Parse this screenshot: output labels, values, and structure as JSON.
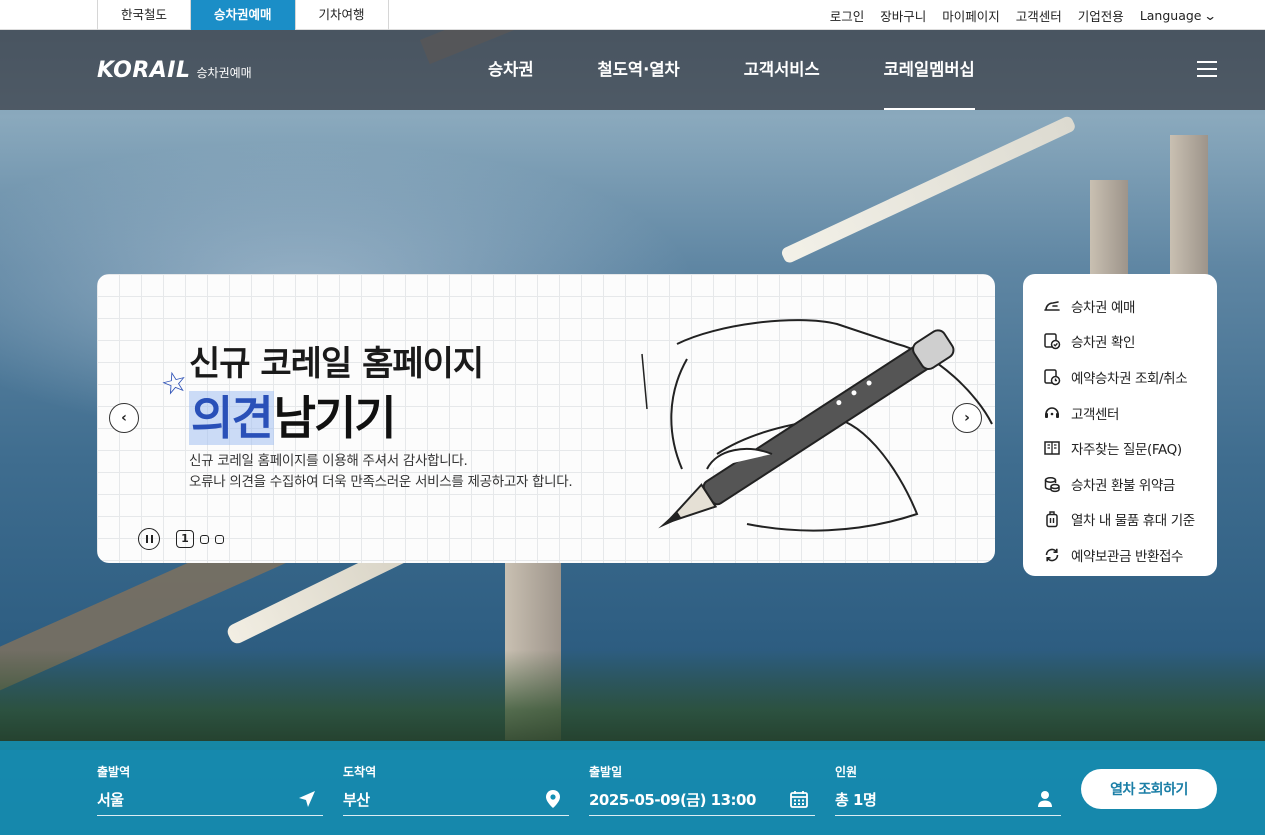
{
  "site_tabs": [
    {
      "label": "한국철도",
      "active": false
    },
    {
      "label": "승차권예매",
      "active": true
    },
    {
      "label": "기차여행",
      "active": false
    }
  ],
  "util_links": {
    "login": "로그인",
    "cart": "장바구니",
    "mypage": "마이페이지",
    "customer_center": "고객센터",
    "business": "기업전용",
    "language": "Language"
  },
  "header": {
    "logo_text": "KORAIL",
    "logo_sub": "승차권예매",
    "nav": [
      {
        "label": "승차권",
        "active": false
      },
      {
        "label": "철도역·열차",
        "active": false
      },
      {
        "label": "고객서비스",
        "active": false
      },
      {
        "label": "코레일멤버십",
        "active": true
      }
    ]
  },
  "banner": {
    "title_line1": "신규 코레일 홈페이지",
    "title_highlight": "의견",
    "title_rest": "남기기",
    "desc_line1": "신규 코레일 홈페이지를 이용해 주셔서 감사합니다.",
    "desc_line2": "오류나 의견을 수집하여 더욱 만족스러운 서비스를 제공하고자 합니다.",
    "current_page": "1",
    "total_pages": 3
  },
  "quick_menu": [
    {
      "label": "승차권 예매",
      "icon": "ticket-icon"
    },
    {
      "label": "승차권 확인",
      "icon": "ticket-check-icon"
    },
    {
      "label": "예약승차권 조회/취소",
      "icon": "reservation-check-icon"
    },
    {
      "label": "고객센터",
      "icon": "headset-icon"
    },
    {
      "label": "자주찾는 질문(FAQ)",
      "icon": "book-icon"
    },
    {
      "label": "승차권 환불 위약금",
      "icon": "coins-icon"
    },
    {
      "label": "열차 내 물품 휴대 기준",
      "icon": "luggage-icon"
    },
    {
      "label": "예약보관금 반환접수",
      "icon": "refresh-icon"
    }
  ],
  "search": {
    "departure": {
      "label": "출발역",
      "value": "서울"
    },
    "arrival": {
      "label": "도착역",
      "value": "부산"
    },
    "date": {
      "label": "출발일",
      "value": "2025-05-09(금) 13:00"
    },
    "passengers": {
      "label": "인원",
      "value": "총 1명"
    },
    "button_label": "열차 조회하기"
  },
  "colors": {
    "accent": "#1b8ec7",
    "search_bar": "#1591b5",
    "highlight_blue": "#2950b8"
  }
}
